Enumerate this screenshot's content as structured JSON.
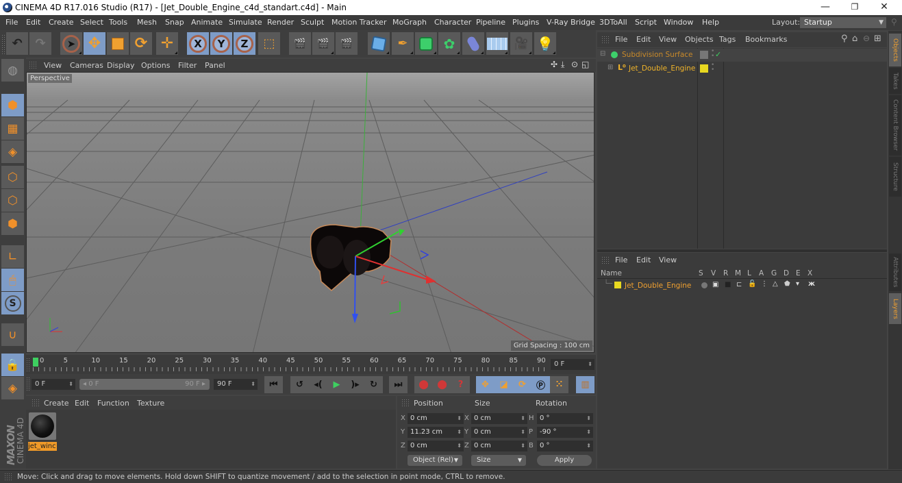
{
  "window": {
    "title": "CINEMA 4D R17.016 Studio (R17) - [Jet_Double_Engine_c4d_standart.c4d] - Main",
    "controls": [
      "minimize",
      "restore",
      "close"
    ]
  },
  "menubar": {
    "items": [
      "File",
      "Edit",
      "Create",
      "Select",
      "Tools",
      "Mesh",
      "Snap",
      "Animate",
      "Simulate",
      "Render",
      "Sculpt",
      "Motion Tracker",
      "MoGraph",
      "Character",
      "Pipeline",
      "Plugins",
      "V-Ray Bridge",
      "3DToAll",
      "Script",
      "Window",
      "Help"
    ],
    "layout_label": "Layout:",
    "layout_value": "Startup"
  },
  "toolbar": {
    "tools": [
      {
        "name": "undo",
        "icon": "undo-icon"
      },
      {
        "name": "redo",
        "icon": "redo-icon"
      },
      {
        "name": "live-selection",
        "icon": "cursor-icon"
      },
      {
        "name": "move",
        "icon": "move-icon"
      },
      {
        "name": "scale",
        "icon": "scale-icon"
      },
      {
        "name": "rotate",
        "icon": "rotate-icon"
      },
      {
        "name": "recent-tools",
        "icon": "move-plus-icon"
      },
      {
        "name": "x-axis",
        "label": "X"
      },
      {
        "name": "y-axis",
        "label": "Y"
      },
      {
        "name": "z-axis",
        "label": "Z"
      },
      {
        "name": "coordinate-system",
        "icon": "world-axis-icon"
      },
      {
        "name": "render-view",
        "icon": "clapper-icon"
      },
      {
        "name": "render-picture-viewer",
        "icon": "clapper-render-icon"
      },
      {
        "name": "render-settings",
        "icon": "clapper-gear-icon"
      },
      {
        "name": "cube",
        "icon": "cube-icon"
      },
      {
        "name": "pen",
        "icon": "pen-icon"
      },
      {
        "name": "subdivision",
        "icon": "subdivision-icon"
      },
      {
        "name": "cloner",
        "icon": "cloner-icon"
      },
      {
        "name": "deformer",
        "icon": "bend-icon"
      },
      {
        "name": "floor",
        "icon": "floor-icon"
      },
      {
        "name": "camera",
        "icon": "camera-icon"
      },
      {
        "name": "light",
        "icon": "light-bulb-icon"
      }
    ]
  },
  "left_tools": [
    "make-editable",
    "model",
    "texture",
    "workplane",
    "points",
    "edges",
    "polygons",
    "axis",
    "tweak",
    "snap",
    "magnet",
    "lock-workplane",
    "workplane-planar"
  ],
  "viewport": {
    "menu": [
      "View",
      "Cameras",
      "Display",
      "Options",
      "Filter",
      "Panel"
    ],
    "camera_label": "Perspective",
    "grid_spacing": "Grid Spacing : 100 cm"
  },
  "timeline": {
    "ticks": [
      "0",
      "5",
      "10",
      "15",
      "20",
      "25",
      "30",
      "35",
      "40",
      "45",
      "50",
      "55",
      "60",
      "65",
      "70",
      "75",
      "80",
      "85",
      "90"
    ],
    "current_frame": "0 F",
    "start_frame": "0 F",
    "range_start": "0 F",
    "range_end": "90 F",
    "end_frame": "90 F"
  },
  "material_manager": {
    "menu": [
      "Create",
      "Edit",
      "Function",
      "Texture"
    ],
    "materials": [
      {
        "name": "jet_wing"
      }
    ],
    "material_label_visible": "jet_winc"
  },
  "branding": {
    "line1": "MAXON",
    "line2": "CINEMA 4D"
  },
  "coordinates": {
    "headers": [
      "Position",
      "Size",
      "Rotation"
    ],
    "position": [
      {
        "axis": "X",
        "value": "0 cm"
      },
      {
        "axis": "Y",
        "value": "11.23 cm"
      },
      {
        "axis": "Z",
        "value": "0 cm"
      }
    ],
    "size": [
      {
        "axis": "X",
        "value": "0 cm"
      },
      {
        "axis": "Y",
        "value": "0 cm"
      },
      {
        "axis": "Z",
        "value": "0 cm"
      }
    ],
    "rotation": [
      {
        "axis": "H",
        "value": "0 °"
      },
      {
        "axis": "P",
        "value": "-90 °"
      },
      {
        "axis": "B",
        "value": "0 °"
      }
    ],
    "mode_dropdown": "Object (Rel)",
    "size_dropdown": "Size",
    "apply_label": "Apply"
  },
  "object_manager": {
    "menu": [
      "File",
      "Edit",
      "View",
      "Objects",
      "Tags",
      "Bookmarks"
    ],
    "objects": [
      {
        "name": "Subdivision Surface",
        "color": "#c98a2a",
        "expanded": true
      },
      {
        "name": "Jet_Double_Engine",
        "color": "#f0b42a",
        "layer_color": "#e8d820"
      }
    ]
  },
  "layer_manager": {
    "menu": [
      "File",
      "Edit",
      "View"
    ],
    "columns": [
      "Name",
      "S",
      "V",
      "R",
      "M",
      "L",
      "A",
      "G",
      "D",
      "E",
      "X"
    ],
    "layers": [
      {
        "name": "Jet_Double_Engine",
        "color": "#e8d820"
      }
    ]
  },
  "right_tabs": {
    "top": [
      {
        "label": "Objects",
        "active": true
      },
      {
        "label": "Takes"
      },
      {
        "label": "Content Browser"
      },
      {
        "label": "Structure"
      }
    ],
    "bottom": [
      {
        "label": "Attributes"
      },
      {
        "label": "Layers",
        "active": true
      }
    ]
  },
  "status": {
    "text": "Move: Click and drag to move elements. Hold down SHIFT to quantize movement / add to the selection in point mode, CTRL to remove."
  },
  "colors": {
    "accent_orange": "#f09a28",
    "selection_blue": "#7e9cc7",
    "axis_x": "#e03030",
    "axis_y": "#30c030",
    "axis_z": "#3040e0"
  }
}
